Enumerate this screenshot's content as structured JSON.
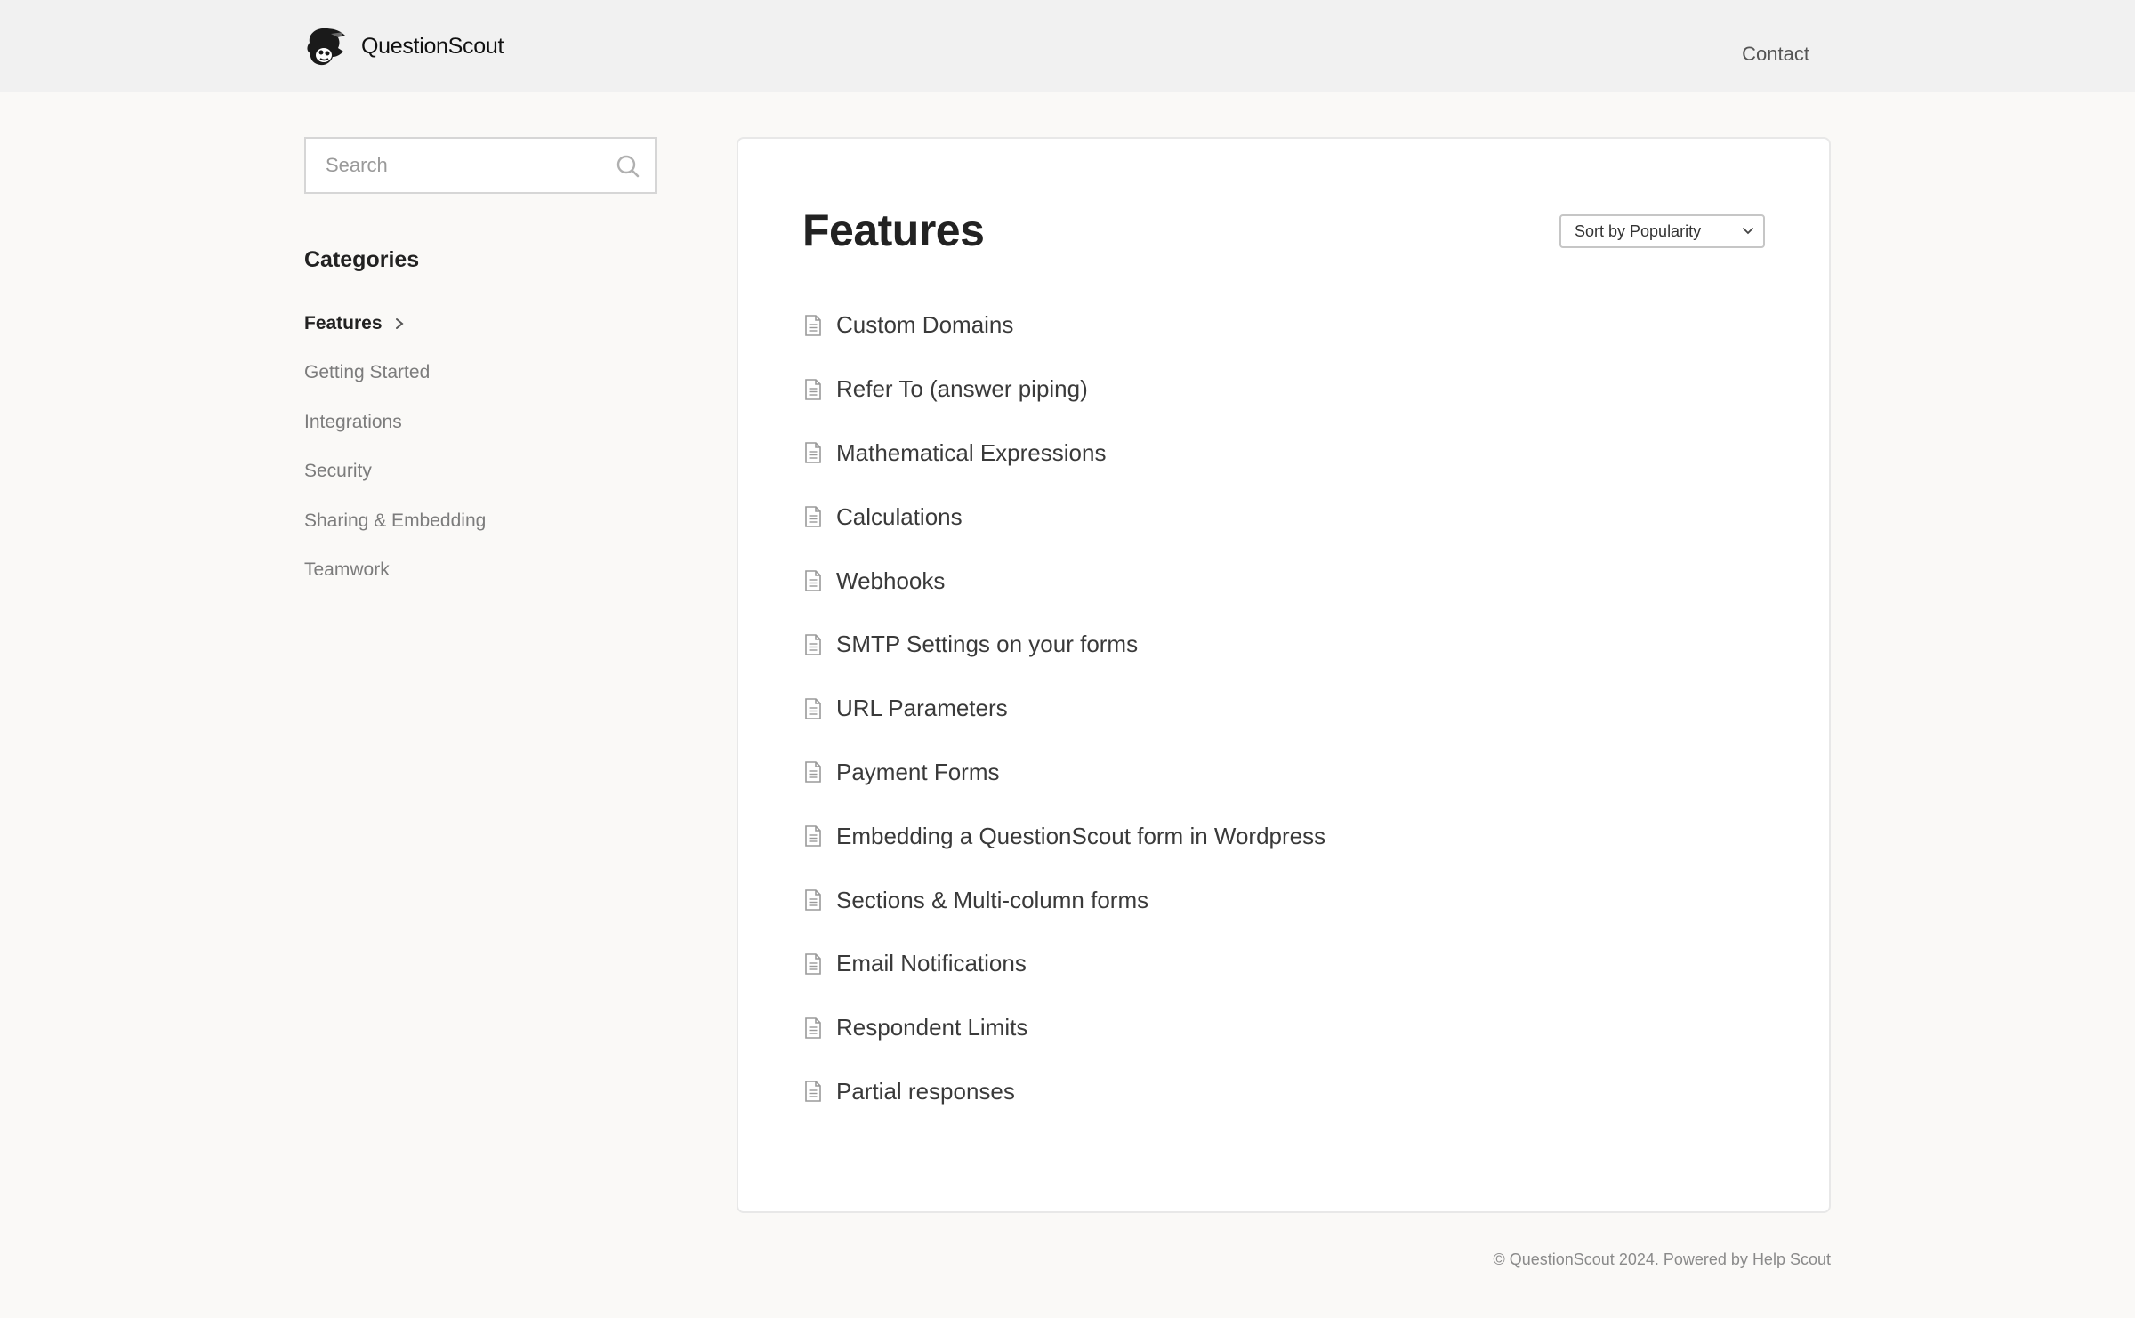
{
  "header": {
    "brand": "QuestionScout",
    "contact_label": "Contact"
  },
  "sidebar": {
    "search_placeholder": "Search",
    "categories_title": "Categories",
    "categories": [
      {
        "label": "Features",
        "active": true
      },
      {
        "label": "Getting Started",
        "active": false
      },
      {
        "label": "Integrations",
        "active": false
      },
      {
        "label": "Security",
        "active": false
      },
      {
        "label": "Sharing & Embedding",
        "active": false
      },
      {
        "label": "Teamwork",
        "active": false
      }
    ]
  },
  "main": {
    "title": "Features",
    "sort_selected": "Sort by Popularity",
    "articles": [
      "Custom Domains",
      "Refer To (answer piping)",
      "Mathematical Expressions",
      "Calculations",
      "Webhooks",
      "SMTP Settings on your forms",
      "URL Parameters",
      "Payment Forms",
      "Embedding a QuestionScout form in Wordpress",
      "Sections & Multi-column forms",
      "Email Notifications",
      "Respondent Limits",
      "Partial responses"
    ]
  },
  "footer": {
    "copyright_symbol": "©",
    "brand_link": "QuestionScout",
    "middle_text": "2024. Powered by",
    "powered_link": "Help Scout"
  },
  "colors": {
    "header_bg": "#f1f1f1",
    "page_bg": "#faf9f7",
    "active_category": "#222222",
    "inactive_category": "#7c7c7c"
  }
}
